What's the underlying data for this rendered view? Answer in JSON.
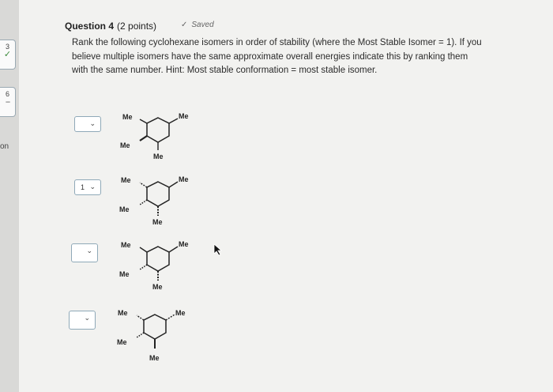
{
  "nav": {
    "q3_number": "3",
    "q3_mark": "✓",
    "q6_number": "6",
    "q6_mark": "--",
    "side_word": "on"
  },
  "question": {
    "title": "Question 4",
    "points": "(2 points)",
    "saved_label": "Saved",
    "text": "Rank the following cyclohexane isomers in order of stability (where the Most Stable Isomer = 1). If you believe multiple isomers have the same approximate overall energies indicate this by ranking them with the same number. Hint: Most stable conformation = most stable isomer."
  },
  "molecule_labels": {
    "substituent": "Me"
  },
  "rankings": [
    {
      "value": ""
    },
    {
      "value": "1"
    },
    {
      "value": ""
    },
    {
      "value": ""
    }
  ],
  "icons": {
    "saved": "check-icon",
    "dropdown": "chevron-down-icon",
    "pointer": "mouse-pointer-icon"
  },
  "colors": {
    "select_border": "#8fa9b8",
    "check_green": "#3c8a3c"
  }
}
